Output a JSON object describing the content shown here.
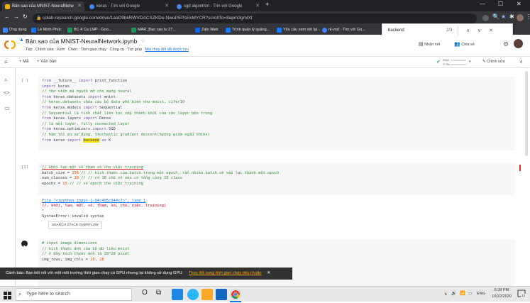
{
  "browser": {
    "tabs": [
      {
        "title": "Bản sao của MNIST-NeuralNetw",
        "active": true,
        "fav_color": "#f9ab00"
      },
      {
        "title": "keras - Tìm với Google",
        "active": false,
        "fav_color": "#4285f4"
      },
      {
        "title": "sgd algorithm - Tìm với Google",
        "active": false,
        "fav_color": "#4285f4"
      }
    ],
    "url": "colab.research.google.com/drive/1aoD9bkRWVDACSZKDe-NwuPEPsEkMYCR?scrollTo=8apm3gmlXt",
    "new_tab_glyph": "+",
    "bookmarks": [
      {
        "label": "Ứng dụng",
        "color": "#4285f4"
      },
      {
        "label": "Lê Minh Phúc",
        "color": "#1a73e8"
      },
      {
        "label": "BC 4 Ca LMP - Goo...",
        "color": "#0f9d58"
      },
      {
        "label": "MAR_Bao cao tu 27...",
        "color": "#0f9d58"
      },
      {
        "label": "Zalo Web",
        "color": "#0068ff"
      },
      {
        "label": "Trình quản lý quảng...",
        "color": "#1877f2"
      },
      {
        "label": "Yêu cầu xem xét lại...",
        "color": "#1877f2"
      },
      {
        "label": "nl-vnd - Tìm với Go...",
        "color": "#4285f4"
      }
    ],
    "find": {
      "query": "backend",
      "count": "2/3"
    }
  },
  "colab": {
    "title": "Bản sao của MNIST-NeuralNetwork.ipynb",
    "menu": [
      "Tệp",
      "Chỉnh sửa",
      "Xem",
      "Chèn",
      "Thời gian chạy",
      "Công cụ",
      "Trợ giúp"
    ],
    "unsaved": "Mọi thay đổi đã được lưu",
    "comment_label": "Nhận xét",
    "share_label": "Chia sẻ",
    "add_code": "+ Mã",
    "add_text": "+ Văn bản",
    "ram_label": "RAM",
    "disk_label": "Ổ đĩa",
    "edit_label": "Chỉnh sửa"
  },
  "cells": {
    "cell1_label": "[ ]",
    "cell2_label": "[1]",
    "error_file": "File \"<ipython-input-1-94c495c944c7>\", line 1",
    "error_line": "(/, khởi, tạo, một, số, tham, số, cho, việc, training)",
    "error_caret": "^",
    "error_msg": "SyntaxError: invalid syntax",
    "search_so": "SEARCH STACK OVERFLOW"
  },
  "snackbar": {
    "message": "Cảnh báo: Bạn kết nối với một môi trường thời gian chạy có GPU nhưng lại không sử dụng GPU.",
    "action": "Thay đổi sang thời gian chạy tiêu chuẩn",
    "close": "✕"
  },
  "taskbar": {
    "search_placeholder": "Type here to search",
    "time": "6:39 PM",
    "date": "10/22/2020",
    "lang": "ENG",
    "notif_count": "23"
  },
  "icons": {
    "search": "search-icon",
    "code": "code-icon",
    "folder": "folder-icon",
    "toc": "menu-icon"
  }
}
